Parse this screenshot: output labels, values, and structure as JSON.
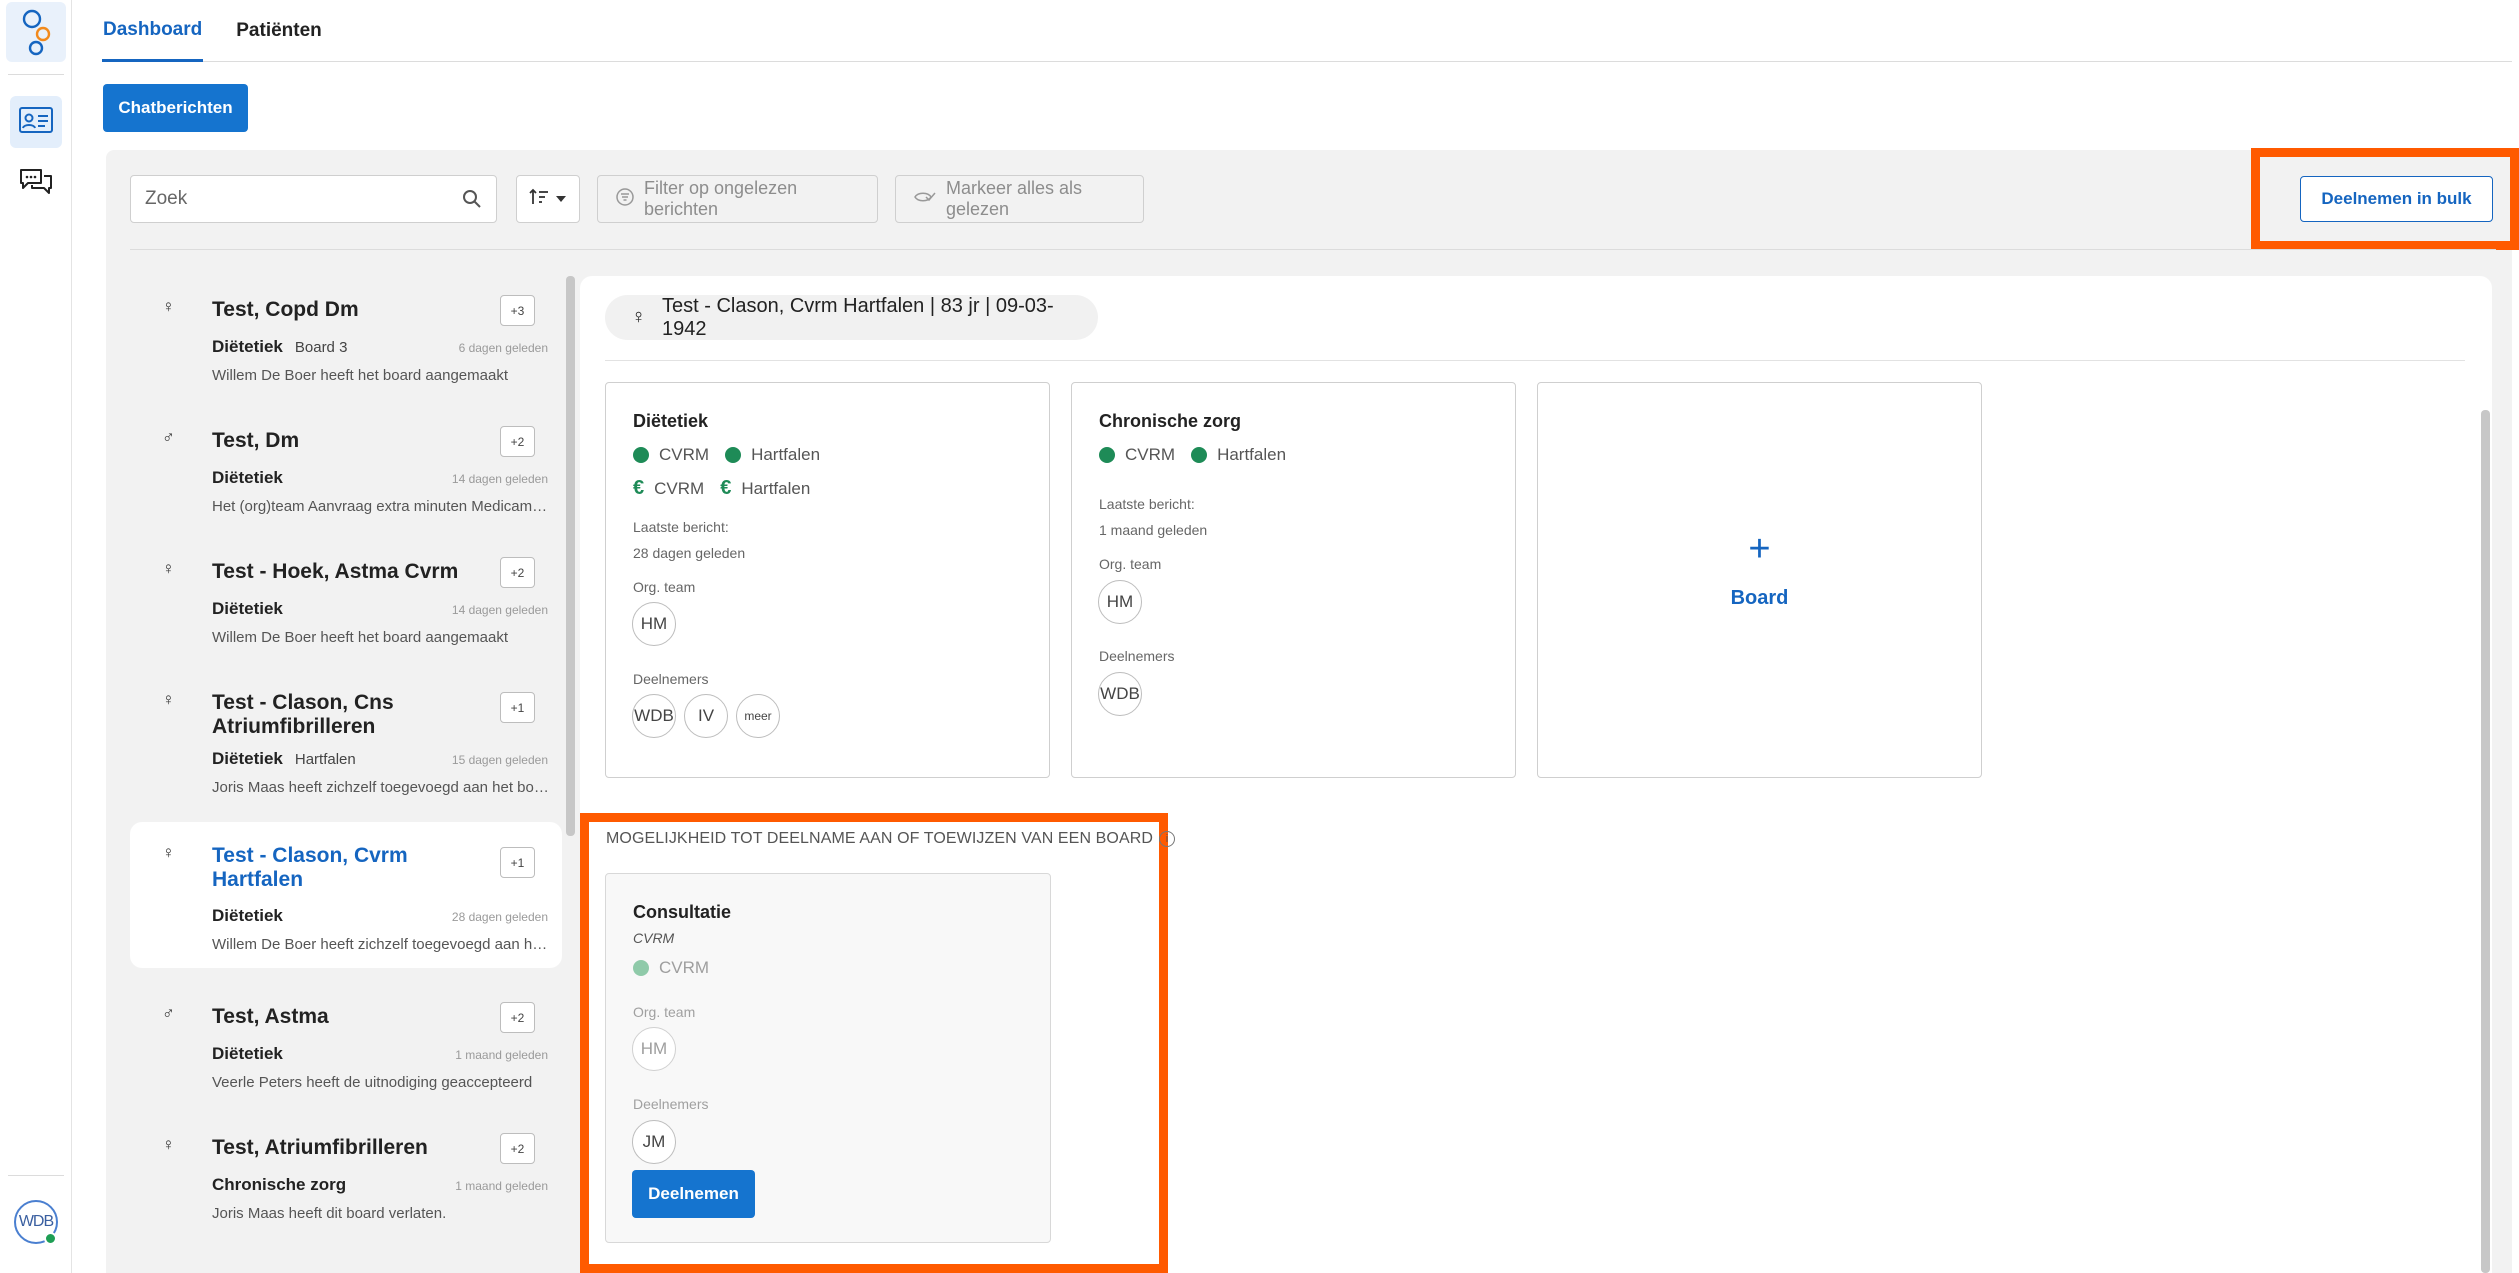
{
  "rail": {
    "user_initials": "WDB"
  },
  "tabs": [
    {
      "label": "Dashboard"
    },
    {
      "label": "Patiënten"
    }
  ],
  "chat_button": "Chatberichten",
  "toolbar": {
    "search_placeholder": "Zoek",
    "filter_unread": "Filter op ongelezen berichten",
    "mark_all_read": "Markeer alles als gelezen",
    "bulk_join": "Deelnemen in bulk"
  },
  "patients": [
    {
      "gender": "♀",
      "name": "Test, Copd Dm",
      "badge": "+3",
      "category": "Diëtetiek",
      "sub": "Board 3",
      "time": "6 dagen geleden",
      "message": "Willem De Boer heeft het board aangemaakt"
    },
    {
      "gender": "♂",
      "name": "Test, Dm",
      "badge": "+2",
      "category": "Diëtetiek",
      "sub": "",
      "time": "14 dagen geleden",
      "message": "Het (org)team Aanvraag extra minuten Medicamu..."
    },
    {
      "gender": "♀",
      "name": "Test - Hoek, Astma Cvrm",
      "badge": "+2",
      "category": "Diëtetiek",
      "sub": "",
      "time": "14 dagen geleden",
      "message": "Willem De Boer heeft het board aangemaakt"
    },
    {
      "gender": "♀",
      "name": "Test - Clason, Cns Atriumfibrilleren",
      "badge": "+1",
      "category": "Diëtetiek",
      "sub": "Hartfalen",
      "time": "15 dagen geleden",
      "message": "Joris Maas heeft zichzelf toegevoegd aan het boar..."
    },
    {
      "gender": "♀",
      "name": "Test - Clason, Cvrm Hartfalen",
      "badge": "+1",
      "category": "Diëtetiek",
      "sub": "",
      "time": "28 dagen geleden",
      "message": "Willem De Boer heeft zichzelf toegevoegd aan het..."
    },
    {
      "gender": "♂",
      "name": "Test, Astma",
      "badge": "+2",
      "category": "Diëtetiek",
      "sub": "",
      "time": "1 maand geleden",
      "message": "Veerle Peters heeft de uitnodiging geaccepteerd"
    },
    {
      "gender": "♀",
      "name": "Test, Atriumfibrilleren",
      "badge": "+2",
      "category": "Chronische zorg",
      "sub": "",
      "time": "1 maand geleden",
      "message": "Joris Maas heeft dit board verlaten."
    }
  ],
  "patient_header": {
    "gender": "♀",
    "text": "Test - Clason, Cvrm Hartfalen | 83 jr | 09-03-1942"
  },
  "boards": [
    {
      "title": "Diëtetiek",
      "tags": [
        "CVRM",
        "Hartfalen"
      ],
      "euro_tags": [
        "CVRM",
        "Hartfalen"
      ],
      "last_message_label": "Laatste bericht:",
      "last_message": "28 dagen geleden",
      "org_team_label": "Org. team",
      "org_team": [
        "HM"
      ],
      "participants_label": "Deelnemers",
      "participants": [
        "WDB",
        "IV",
        "meer"
      ]
    },
    {
      "title": "Chronische zorg",
      "tags": [
        "CVRM",
        "Hartfalen"
      ],
      "last_message_label": "Laatste bericht:",
      "last_message": "1 maand geleden",
      "org_team_label": "Org. team",
      "org_team": [
        "HM"
      ],
      "participants_label": "Deelnemers",
      "participants": [
        "WDB"
      ]
    }
  ],
  "add_board": {
    "plus": "+",
    "label": "Board"
  },
  "opportunity": {
    "section_title": "MOGELIJKHEID TOT DEELNAME AAN OF TOEWIJZEN VAN EEN BOARD",
    "info": "i",
    "title": "Consultatie",
    "type": "CVRM",
    "tag": "CVRM",
    "org_team_label": "Org. team",
    "org_team": "HM",
    "participants_label": "Deelnemers",
    "participant": "JM",
    "join_button": "Deelnemen"
  },
  "colors": {
    "accent": "#1574cf",
    "highlight": "#ff5a00",
    "status_green": "#1e8b57"
  }
}
